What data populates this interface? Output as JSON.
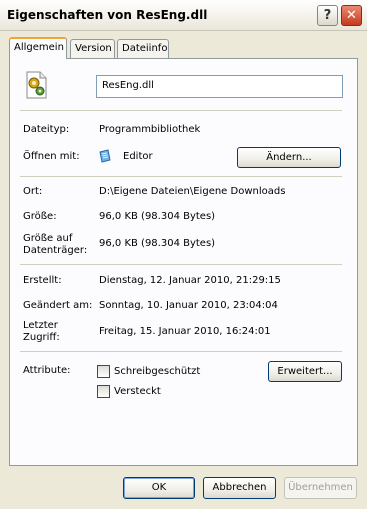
{
  "window": {
    "title": "Eigenschaften von ResEng.dll"
  },
  "titlebar": {
    "help_glyph": "?",
    "close_glyph": "✕"
  },
  "tabs": [
    {
      "label": "Allgemein",
      "active": true
    },
    {
      "label": "Version",
      "active": false
    },
    {
      "label": "Dateiinfo",
      "active": false
    }
  ],
  "general": {
    "file_name": "ResEng.dll",
    "icon": "dll-file-icon",
    "type_label": "Dateityp:",
    "type_value": "Programmbibliothek",
    "opens_with_label": "Öffnen mit:",
    "opens_with_value": "Editor",
    "change_button": "Ändern...",
    "location_label": "Ort:",
    "location_value": "D:\\Eigene Dateien\\Eigene Downloads",
    "size_label": "Größe:",
    "size_value": "96,0 KB (98.304 Bytes)",
    "size_on_disk_label_1": "Größe auf",
    "size_on_disk_label_2": "Datenträger:",
    "size_on_disk_value": "96,0 KB (98.304 Bytes)",
    "created_label": "Erstellt:",
    "created_value": "Dienstag, 12. Januar 2010, 21:29:15",
    "modified_label": "Geändert am:",
    "modified_value": "Sonntag, 10. Januar 2010, 23:04:04",
    "accessed_label_1": "Letzter",
    "accessed_label_2": "Zugriff:",
    "accessed_value": "Freitag, 15. Januar 2010, 16:24:01",
    "attributes_label": "Attribute:",
    "readonly_label": "Schreibgeschützt",
    "readonly_checked": false,
    "hidden_label": "Versteckt",
    "hidden_checked": false,
    "advanced_button": "Erweitert..."
  },
  "footer": {
    "ok_button": "OK",
    "cancel_button": "Abbrechen",
    "apply_button": "Übernehmen"
  },
  "colors": {
    "window_bg": "#ece9d8",
    "panel_bg": "#fcfcfe",
    "active_tab_accent": "#f1a33a",
    "button_border": "#003c74",
    "close_button": "#c63a1e"
  }
}
